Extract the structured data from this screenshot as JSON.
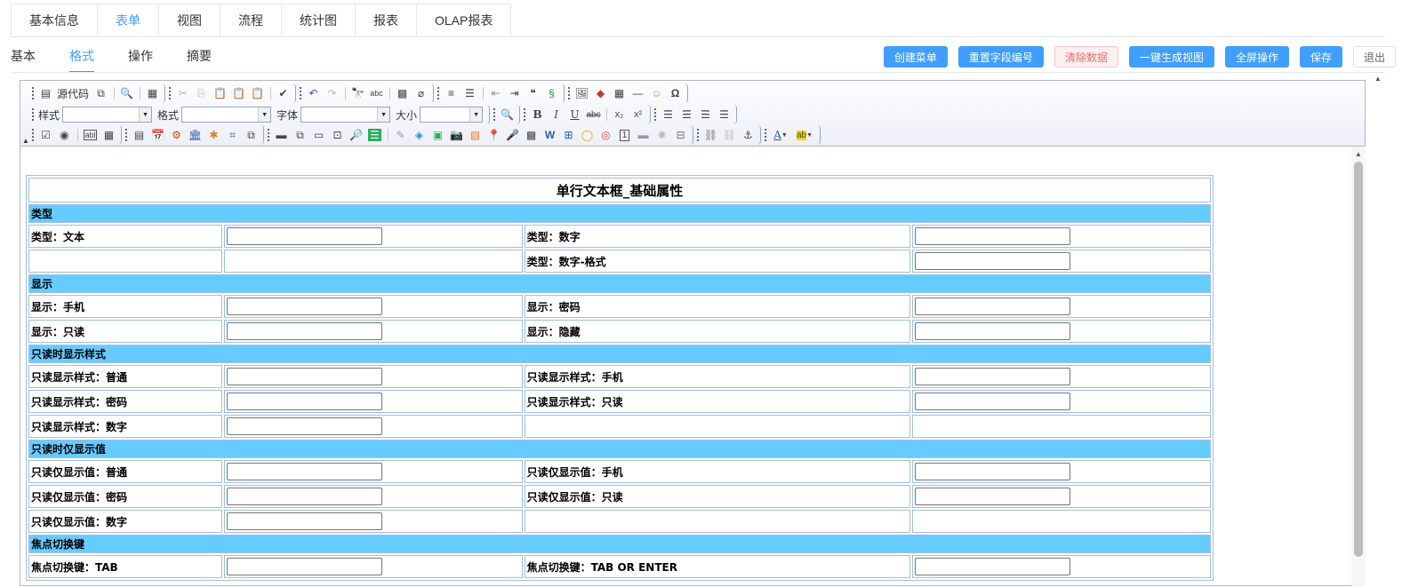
{
  "top_tabs": [
    {
      "label": "基本信息",
      "active": false
    },
    {
      "label": "表单",
      "active": true
    },
    {
      "label": "视图",
      "active": false
    },
    {
      "label": "流程",
      "active": false
    },
    {
      "label": "统计图",
      "active": false
    },
    {
      "label": "报表",
      "active": false
    },
    {
      "label": "OLAP报表",
      "active": false
    }
  ],
  "sub_tabs": [
    {
      "label": "基本",
      "active": false
    },
    {
      "label": "格式",
      "active": true
    },
    {
      "label": "操作",
      "active": false
    },
    {
      "label": "摘要",
      "active": false
    }
  ],
  "buttons": {
    "create_menu": "创建菜单",
    "reset_field_no": "重置字段编号",
    "clear_data": "清除数据",
    "gen_view": "一键生成视图",
    "fullscreen": "全屏操作",
    "save": "保存",
    "exit": "退出"
  },
  "toolbar": {
    "source_label": "源代码",
    "style_label": "样式",
    "format_label": "格式",
    "font_label": "字体",
    "size_label": "大小"
  },
  "form": {
    "title": "单行文本框_基础属性",
    "sections": {
      "type": "类型",
      "display": "显示",
      "readonly_style": "只读时显示样式",
      "readonly_value": "只读时仅显示值",
      "focus_key": "焦点切换键"
    },
    "labels": {
      "type_text": "类型：文本",
      "type_number": "类型：数字",
      "type_number_format": "类型：数字-格式",
      "display_mobile": "显示：手机",
      "display_password": "显示：密码",
      "display_readonly": "显示：只读",
      "display_hidden": "显示：隐藏",
      "ro_style_normal": "只读显示样式：普通",
      "ro_style_mobile": "只读显示样式：手机",
      "ro_style_password": "只读显示样式：密码",
      "ro_style_readonly": "只读显示样式：只读",
      "ro_style_number": "只读显示样式：数字",
      "ro_value_normal": "只读仅显示值：普通",
      "ro_value_mobile": "只读仅显示值：手机",
      "ro_value_password": "只读仅显示值：密码",
      "ro_value_readonly": "只读仅显示值：只读",
      "ro_value_number": "只读仅显示值：数字",
      "focus_tab": "焦点切换键：TAB",
      "focus_tab_enter": "焦点切换键：TAB OR ENTER"
    }
  },
  "colors": {
    "accent": "#409eff",
    "section_bg": "#66ccff",
    "danger": "#f56c6c"
  }
}
